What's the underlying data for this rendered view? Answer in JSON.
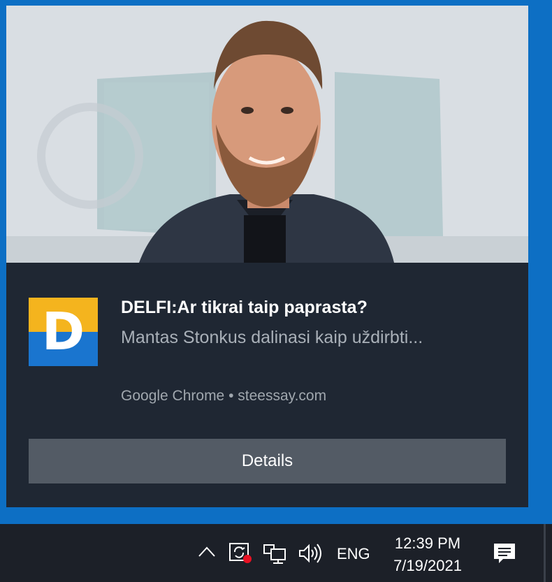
{
  "notification": {
    "app_logo_letter": "D",
    "title": "DELFI:Ar tikrai taip paprasta?",
    "body": "Mantas Stonkus dalinasi kaip uždirbti...",
    "attribution": "Google Chrome • steessay.com",
    "details_label": "Details",
    "hero_image": "photo-of-man-in-front-of-building"
  },
  "taskbar": {
    "language": "ENG",
    "time": "12:39 PM",
    "date": "7/19/2021",
    "icons": [
      "chevron-up-icon",
      "sync-notification-icon",
      "network-icon",
      "volume-icon",
      "action-center-icon"
    ]
  },
  "colors": {
    "desktop_blue": "#0d6fc4",
    "toast_bg": "#1f2733",
    "button_bg": "#535b65",
    "logo_yellow": "#f4b41e",
    "logo_blue": "#1a75cf",
    "taskbar_bg": "#1c2028",
    "record_dot": "#e81123"
  }
}
